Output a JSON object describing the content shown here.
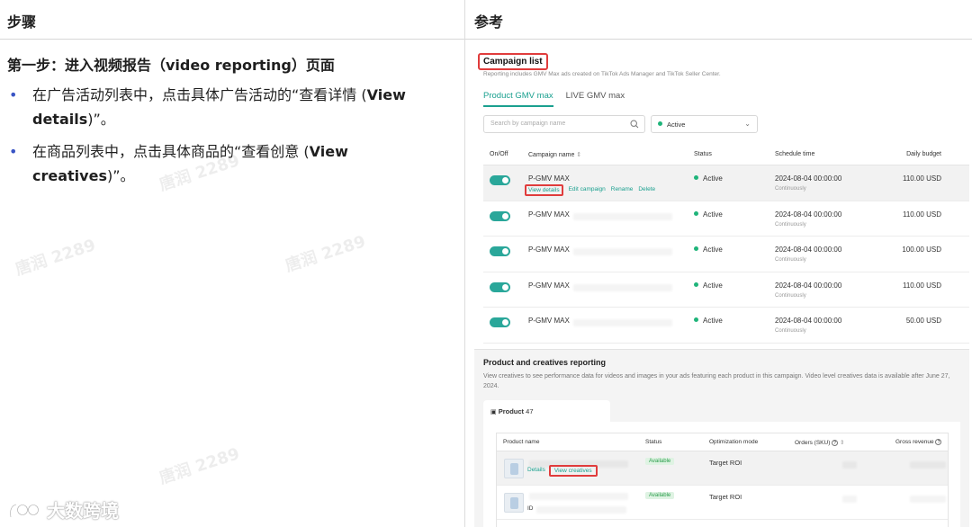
{
  "table": {
    "header_left": "步骤",
    "header_right": "参考"
  },
  "left": {
    "step_title": "第一步：进入视频报告（video reporting）页面",
    "bullets": [
      {
        "prefix": "在广告活动列表中，点击具体广告活动的“查看详情 (",
        "bold": "View details",
        "suffix": ")”。"
      },
      {
        "prefix": "在商品列表中，点击具体商品的“查看创意 (",
        "bold": "View creatives",
        "suffix": ")”。"
      }
    ],
    "watermarks": [
      "唐润 2289",
      "唐润 2289",
      "唐润 2289",
      "唐润 2289"
    ],
    "logo_text": "大数跨境"
  },
  "screenshot": {
    "campaign_list_title": "Campaign list",
    "campaign_list_desc": "Reporting includes GMV Max ads created on TikTok Ads Manager and TikTok Seller Center.",
    "tabs": [
      {
        "label": "Product GMV max",
        "active": true
      },
      {
        "label": "LIVE GMV max",
        "active": false
      }
    ],
    "search_placeholder": "Search by campaign name",
    "status_filter": "Active",
    "columns": {
      "onoff": "On/Off",
      "name": "Campaign name",
      "status": "Status",
      "schedule": "Schedule time",
      "budget": "Daily budget"
    },
    "rows": [
      {
        "name": "P-GMV MAX",
        "status": "Active",
        "schedule": "2024-08-04 00:00:00",
        "schedule_sub": "Continuously",
        "budget": "110.00 USD",
        "highlight": true
      },
      {
        "name": "P-GMV MAX",
        "status": "Active",
        "schedule": "2024-08-04 00:00:00",
        "schedule_sub": "Continuously",
        "budget": "110.00 USD"
      },
      {
        "name": "P-GMV MAX",
        "status": "Active",
        "schedule": "2024-08-04 00:00:00",
        "schedule_sub": "Continuously",
        "budget": "100.00 USD"
      },
      {
        "name": "P-GMV MAX",
        "status": "Active",
        "schedule": "2024-08-04 00:00:00",
        "schedule_sub": "Continuously",
        "budget": "110.00 USD"
      },
      {
        "name": "P-GMV MAX",
        "status": "Active",
        "schedule": "2024-08-04 00:00:00",
        "schedule_sub": "Continuously",
        "budget": "50.00 USD"
      }
    ],
    "row_actions": [
      "View details",
      "Edit campaign",
      "Rename",
      "Delete"
    ],
    "pc_title": "Product and creatives reporting",
    "pc_desc": "View creatives to see performance data for videos and images in your ads featuring each product in this campaign. Video level creatives data is available after June 27, 2024.",
    "product_tab": {
      "label": "Product",
      "count": "47"
    },
    "product_columns": {
      "name": "Product name",
      "status": "Status",
      "mode": "Optimization mode",
      "orders": "Orders (SKU)",
      "revenue": "Gross revenue"
    },
    "product_rows": [
      {
        "status": "Available",
        "mode": "Target ROI",
        "actions": [
          "Details",
          "View creatives"
        ],
        "highlight": true
      },
      {
        "status": "Available",
        "mode": "Target ROI",
        "id_label": "ID"
      }
    ]
  }
}
